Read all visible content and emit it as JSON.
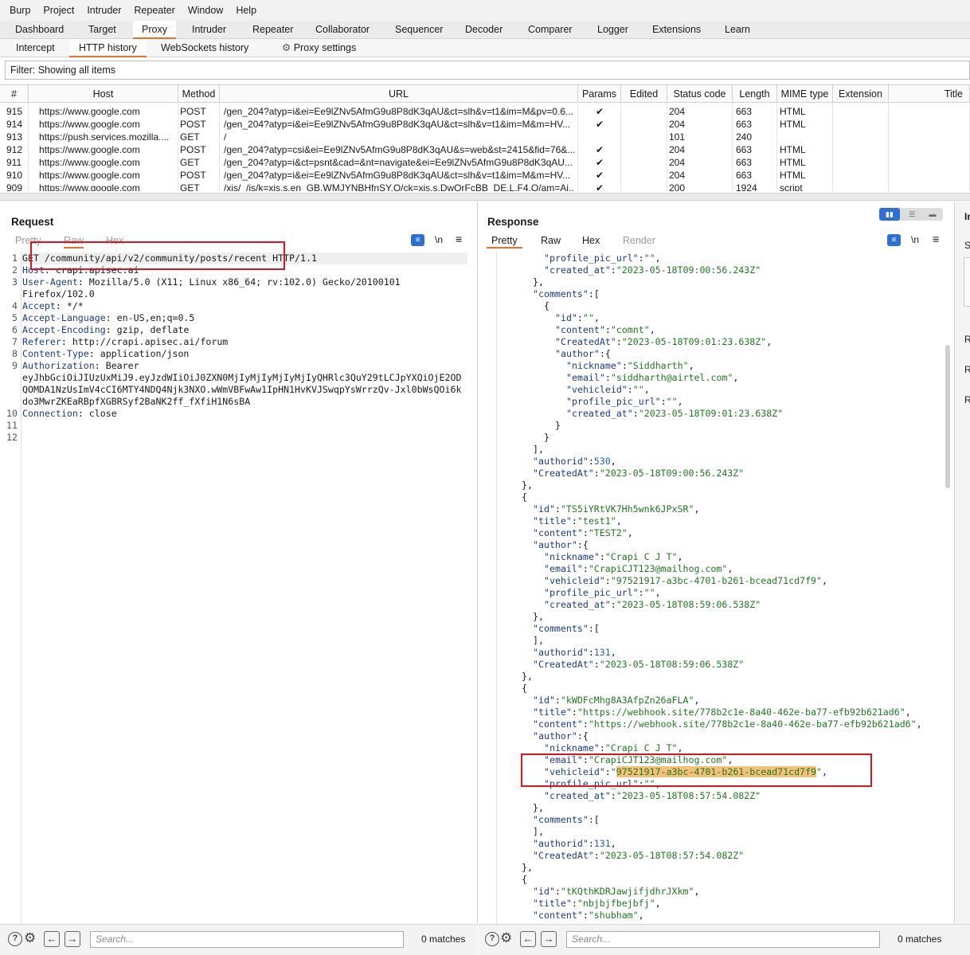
{
  "menu": [
    "Burp",
    "Project",
    "Intruder",
    "Repeater",
    "Window",
    "Help"
  ],
  "main_tabs": [
    "Dashboard",
    "Target",
    "Proxy",
    "Intruder",
    "Repeater",
    "Collaborator",
    "Sequencer",
    "Decoder",
    "Comparer",
    "Logger",
    "Extensions",
    "Learn"
  ],
  "proxy_tabs": [
    "Intercept",
    "HTTP history",
    "WebSockets history",
    "Proxy settings"
  ],
  "filter_text": "Filter: Showing all items",
  "table": {
    "headers": [
      "#",
      "Host",
      "Method",
      "URL",
      "Params",
      "Edited",
      "Status code",
      "Length",
      "MIME type",
      "Extension",
      "Title"
    ],
    "rows": [
      [
        "915",
        "https://www.google.com",
        "POST",
        "/gen_204?atyp=i&ei=Ee9lZNv5AfmG9u8P8dK3qAU&ct=slh&v=t1&im=M&pv=0.6...",
        "✔",
        "",
        "204",
        "663",
        "HTML"
      ],
      [
        "914",
        "https://www.google.com",
        "POST",
        "/gen_204?atyp=i&ei=Ee9lZNv5AfmG9u8P8dK3qAU&ct=slh&v=t1&im=M&m=HV...",
        "✔",
        "",
        "204",
        "663",
        "HTML"
      ],
      [
        "913",
        "https://push.services.mozilla....",
        "GET",
        "/",
        "",
        "",
        "101",
        "240",
        ""
      ],
      [
        "912",
        "https://www.google.com",
        "POST",
        "/gen_204?atyp=csi&ei=Ee9lZNv5AfmG9u8P8dK3qAU&s=web&st=2415&fid=76&...",
        "✔",
        "",
        "204",
        "663",
        "HTML"
      ],
      [
        "911",
        "https://www.google.com",
        "GET",
        "/gen_204?atyp=i&ct=psnt&cad=&nt=navigate&ei=Ee9lZNv5AfmG9u8P8dK3qAU...",
        "✔",
        "",
        "204",
        "663",
        "HTML"
      ],
      [
        "910",
        "https://www.google.com",
        "POST",
        "/gen_204?atyp=i&ei=Ee9lZNv5AfmG9u8P8dK3qAU&ct=slh&v=t1&im=M&m=HV...",
        "✔",
        "",
        "204",
        "663",
        "HTML"
      ],
      [
        "909",
        "https://www.google.com",
        "GET",
        "/xjs/_/js/k=xjs.s.en_GB.WMJYNBHfnSY.O/ck=xjs.s.DwQrFcBB_DE.L.F4.O/am=Ai...",
        "✔",
        "",
        "200",
        "1924",
        "script"
      ]
    ]
  },
  "request": {
    "title": "Request",
    "tabs": [
      "Pretty",
      "Raw",
      "Hex"
    ],
    "newline_label": "\\n",
    "lines": [
      {
        "n": "1",
        "k": "",
        "v": "GET /community/api/v2/community/posts/recent HTTP/1.1"
      },
      {
        "n": "2",
        "k": "Host",
        "v": ": crapi.apisec.ai"
      },
      {
        "n": "3",
        "k": "User-Agent",
        "v": ": Mozilla/5.0 (X11; Linux x86_64; rv:102.0) Gecko/20100101"
      },
      {
        "n": "",
        "k": "",
        "v": "Firefox/102.0"
      },
      {
        "n": "4",
        "k": "Accept",
        "v": ": */*"
      },
      {
        "n": "5",
        "k": "Accept-Language",
        "v": ": en-US,en;q=0.5"
      },
      {
        "n": "6",
        "k": "Accept-Encoding",
        "v": ": gzip, deflate"
      },
      {
        "n": "7",
        "k": "Referer",
        "v": ": http://crapi.apisec.ai/forum"
      },
      {
        "n": "8",
        "k": "Content-Type",
        "v": ": application/json"
      },
      {
        "n": "9",
        "k": "Authorization",
        "v": ": Bearer"
      },
      {
        "n": "",
        "k": "",
        "v": "eyJhbGciOiJIUzUxMiJ9.eyJzdWIiOiJ0ZXN0MjIyMjIyMjIyMjIyQHRlc3QuY29tLCJpYXQiOjE2OD"
      },
      {
        "n": "",
        "k": "",
        "v": "QOMDA1NzUsImV4cCI6MTY4NDQ4Njk3NXO.wWmVBFwAw1IpHN1HvKVJSwqpYsWrrzQv-Jxl0bWsQOi6k"
      },
      {
        "n": "",
        "k": "",
        "v": "do3MwrZKEaRBpfXGBRSyf2BaNK2ff_fXfiH1N6sBA"
      },
      {
        "n": "10",
        "k": "Connection",
        "v": ": close"
      },
      {
        "n": "11",
        "k": "",
        "v": ""
      },
      {
        "n": "12",
        "k": "",
        "v": ""
      }
    ],
    "search_placeholder": "Search...",
    "matches": "0 matches"
  },
  "response": {
    "title": "Response",
    "tabs": [
      "Pretty",
      "Raw",
      "Hex",
      "Render"
    ],
    "newline_label": "\\n",
    "lines": [
      {
        "i": 3,
        "t": "\"profile_pic_url\":\"\","
      },
      {
        "i": 3,
        "t": "\"created_at\":\"2023-05-18T09:00:56.243Z\""
      },
      {
        "i": 2,
        "t": "},"
      },
      {
        "i": 2,
        "t": "\"comments\":["
      },
      {
        "i": 3,
        "t": "{"
      },
      {
        "i": 4,
        "t": "\"id\":\"\","
      },
      {
        "i": 4,
        "t": "\"content\":\"comnt\","
      },
      {
        "i": 4,
        "t": "\"CreatedAt\":\"2023-05-18T09:01:23.638Z\","
      },
      {
        "i": 4,
        "t": "\"author\":{"
      },
      {
        "i": 5,
        "t": "\"nickname\":\"Siddharth\","
      },
      {
        "i": 5,
        "t": "\"email\":\"siddharth@airtel.com\","
      },
      {
        "i": 5,
        "t": "\"vehicleid\":\"\","
      },
      {
        "i": 5,
        "t": "\"profile_pic_url\":\"\","
      },
      {
        "i": 5,
        "t": "\"created_at\":\"2023-05-18T09:01:23.638Z\""
      },
      {
        "i": 4,
        "t": "}"
      },
      {
        "i": 3,
        "t": "}"
      },
      {
        "i": 2,
        "t": "],"
      },
      {
        "i": 2,
        "t": "\"authorid\":530,"
      },
      {
        "i": 2,
        "t": "\"CreatedAt\":\"2023-05-18T09:00:56.243Z\""
      },
      {
        "i": 1,
        "t": "},"
      },
      {
        "i": 1,
        "t": "{"
      },
      {
        "i": 2,
        "t": "\"id\":\"TS5iYRtVK7Hh5wnk6JPxSR\","
      },
      {
        "i": 2,
        "t": "\"title\":\"test1\","
      },
      {
        "i": 2,
        "t": "\"content\":\"TEST2\","
      },
      {
        "i": 2,
        "t": "\"author\":{"
      },
      {
        "i": 3,
        "t": "\"nickname\":\"Crapi C J T\","
      },
      {
        "i": 3,
        "t": "\"email\":\"CrapiCJT123@mailhog.com\","
      },
      {
        "i": 3,
        "t": "\"vehicleid\":\"97521917-a3bc-4701-b261-bcead71cd7f9\","
      },
      {
        "i": 3,
        "t": "\"profile_pic_url\":\"\","
      },
      {
        "i": 3,
        "t": "\"created_at\":\"2023-05-18T08:59:06.538Z\""
      },
      {
        "i": 2,
        "t": "},"
      },
      {
        "i": 2,
        "t": "\"comments\":["
      },
      {
        "i": 2,
        "t": "],"
      },
      {
        "i": 2,
        "t": "\"authorid\":131,"
      },
      {
        "i": 2,
        "t": "\"CreatedAt\":\"2023-05-18T08:59:06.538Z\""
      },
      {
        "i": 1,
        "t": "},"
      },
      {
        "i": 1,
        "t": "{"
      },
      {
        "i": 2,
        "t": "\"id\":\"kWDFcMhg8A3AfpZn26aFLA\","
      },
      {
        "i": 2,
        "t": "\"title\":\"https://webhook.site/778b2c1e-8a40-462e-ba77-efb92b621ad6\","
      },
      {
        "i": 2,
        "t": "\"content\":\"https://webhook.site/778b2c1e-8a40-462e-ba77-efb92b621ad6\","
      },
      {
        "i": 2,
        "t": "\"author\":{"
      },
      {
        "i": 3,
        "t": "\"nickname\":\"Crapi C J T\","
      },
      {
        "i": 3,
        "t": "\"email\":\"CrapiCJT123@mailhog.com\","
      },
      {
        "i": 3,
        "t": "\"vehicleid\":\"97521917-a3bc-4701-b261-bcead71cd7f9\",",
        "hl": true
      },
      {
        "i": 3,
        "t": "\"profile_pic_url\":\"\","
      },
      {
        "i": 3,
        "t": "\"created_at\":\"2023-05-18T08:57:54.082Z\""
      },
      {
        "i": 2,
        "t": "},"
      },
      {
        "i": 2,
        "t": "\"comments\":["
      },
      {
        "i": 2,
        "t": "],"
      },
      {
        "i": 2,
        "t": "\"authorid\":131,"
      },
      {
        "i": 2,
        "t": "\"CreatedAt\":\"2023-05-18T08:57:54.082Z\""
      },
      {
        "i": 1,
        "t": "},"
      },
      {
        "i": 1,
        "t": "{"
      },
      {
        "i": 2,
        "t": "\"id\":\"tKQthKDRJawjifjdhrJXkm\","
      },
      {
        "i": 2,
        "t": "\"title\":\"nbjbjfbejbfj\","
      },
      {
        "i": 2,
        "t": "\"content\":\"shubham\","
      }
    ],
    "search_placeholder": "Search...",
    "matches": "0 matches"
  },
  "inspector_letters": [
    "In",
    "Se",
    "R",
    "R",
    "R"
  ],
  "colors": {
    "accent": "#e8702a",
    "highlight": "#f5c07a",
    "annotation": "#e0141e",
    "key": "#1a3c8c",
    "string": "#1f7a1f"
  }
}
